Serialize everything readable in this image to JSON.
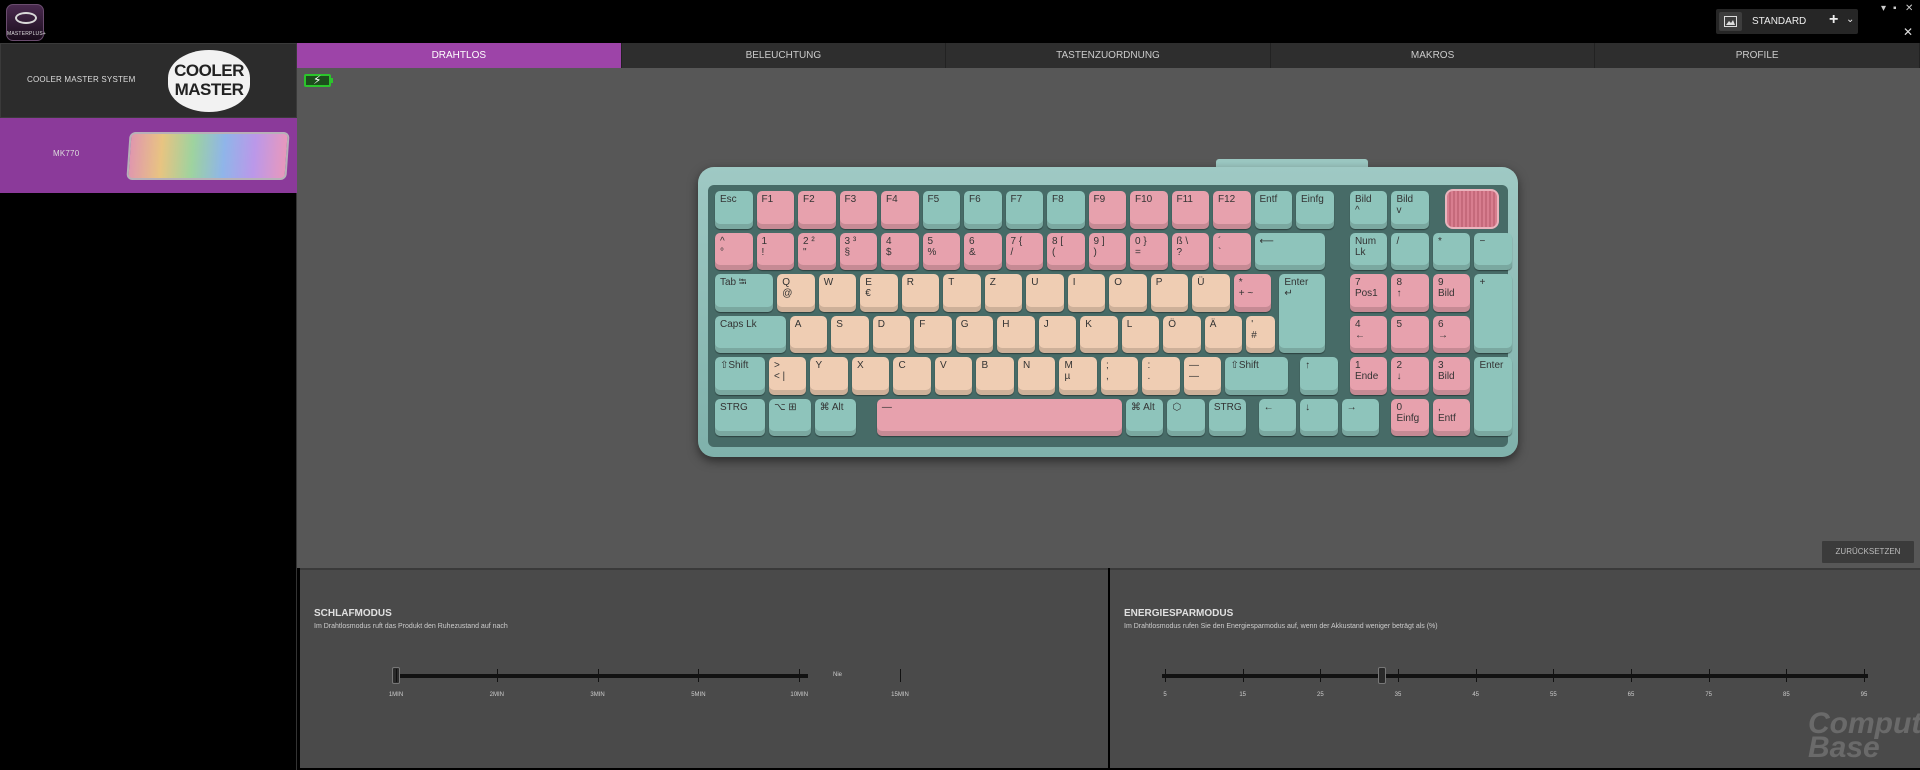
{
  "app": {
    "logo_text": "MASTERPLUS+"
  },
  "profile": {
    "name": "STANDARD",
    "add": "+",
    "dropdown": "⌄"
  },
  "window": {
    "minimize": "▾",
    "maximize": "▪",
    "close": "✕",
    "sidebar_close": "✕"
  },
  "sidebar": {
    "items": [
      {
        "label": "COOLER MASTER SYSTEM",
        "logo": "COOLER\nMASTER"
      },
      {
        "label": "MK770",
        "active": true
      }
    ]
  },
  "tabs": [
    {
      "label": "DRAHTLOS",
      "active": true
    },
    {
      "label": "BELEUCHTUNG"
    },
    {
      "label": "TASTENZUORDNUNG"
    },
    {
      "label": "MAKROS"
    },
    {
      "label": "PROFILE"
    }
  ],
  "reset_button": "ZURÜCKSETZEN",
  "sleep": {
    "title": "SCHLAFMODUS",
    "description": "Im Drahtlosmodus ruft das Produkt den Ruhezustand auf nach",
    "ticks": [
      "1MIN",
      "2MIN",
      "3MIN",
      "5MIN",
      "10MIN",
      "15MIN"
    ],
    "max_label": "Nie",
    "value": "1MIN"
  },
  "energy": {
    "title": "ENERGIESPARMODUS",
    "description": "Im Drahtlosmodus rufen Sie den Energiesparmodus auf, wenn der Akkustand weniger beträgt als (%)",
    "ticks": [
      "5",
      "15",
      "25",
      "35",
      "45",
      "55",
      "65",
      "75",
      "85",
      "95"
    ],
    "value": 30
  },
  "keyboard": {
    "rows": [
      [
        "Esc",
        "F1",
        "F2",
        "F3",
        "F4",
        "F5",
        "F6",
        "F7",
        "F8",
        "F9",
        "F10",
        "F11",
        "F12",
        "Entf",
        "Einfg",
        "Bild\n^",
        "Bild\nv"
      ],
      [
        "^\n°",
        "1\n!",
        "2 ²\n\"",
        "3 ³\n§",
        "4\n$",
        "5\n%",
        "6\n&",
        "7 {\n/",
        "8 [\n(",
        "9 ]\n)",
        "0 }\n=",
        "ß \\\n?",
        "´\n`",
        "⟵",
        "Num\nLk",
        "/",
        "*",
        "−"
      ],
      [
        "Tab ⭾",
        "Q\n@",
        "W",
        "E\n€",
        "R",
        "T",
        "Z",
        "U",
        "I",
        "O",
        "P",
        "Ü",
        "*\n+ ~",
        "Enter\n↵",
        "7\nPos1",
        "8\n↑",
        "9\nBild",
        "+"
      ],
      [
        "Caps Lk",
        "A",
        "S",
        "D",
        "F",
        "G",
        "H",
        "J",
        "K",
        "L",
        "Ö",
        "Ä",
        "'\n#",
        "4\n←",
        "5",
        "6\n→"
      ],
      [
        "⇧Shift",
        ">\n< |",
        "Y",
        "X",
        "C",
        "V",
        "B",
        "N",
        "M\nµ",
        ";\n,",
        ":\n.",
        "—\n—",
        "⇧Shift",
        "↑",
        "1\nEnde",
        "2\n↓",
        "3\nBild",
        "Enter"
      ],
      [
        "STRG",
        "⌥ ⊞",
        "⌘ Alt",
        "—",
        "⌘ Alt",
        "⬡",
        "STRG",
        "←",
        "↓",
        "→",
        "0\nEinfg",
        ",\nEntf"
      ]
    ]
  },
  "watermark": "Computer\nBase"
}
